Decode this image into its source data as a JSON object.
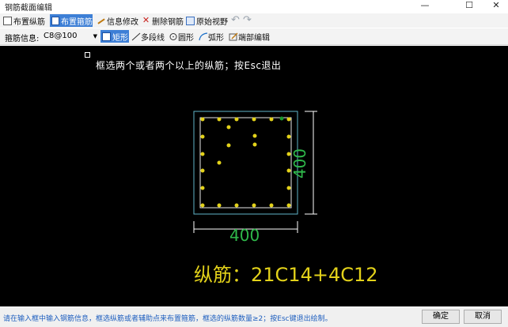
{
  "window": {
    "title": "钢筋截面编辑",
    "min_glyph": "—",
    "max_glyph": "☐",
    "close_glyph": "✕"
  },
  "toolbar1": {
    "items": [
      {
        "label": "布置纵筋",
        "icon": "square-icon"
      },
      {
        "label": "布置箍筋",
        "icon": "stirrup-icon",
        "active": true
      },
      {
        "label": "信息修改",
        "icon": "pencil-icon"
      },
      {
        "label": "删除钢筋",
        "icon": "delete-x-icon"
      },
      {
        "label": "原始视野",
        "icon": "zoom-extents-icon"
      }
    ],
    "undo_glyph": "↶",
    "redo_glyph": "↷"
  },
  "toolbar2": {
    "stirrup_label": "箍筋信息:",
    "stirrup_value": "C8@100",
    "shapes": [
      {
        "label": "矩形",
        "icon": "rect-icon",
        "active": true
      },
      {
        "label": "多段线",
        "icon": "polyline-icon"
      },
      {
        "label": "圆形",
        "icon": "circle-icon"
      },
      {
        "label": "弧形",
        "icon": "arc-icon"
      },
      {
        "label": "端部编辑",
        "icon": "end-edit-icon"
      }
    ]
  },
  "canvas": {
    "prompt": "框选两个或者两个以上的纵筋；按Esc退出",
    "dim_width": "400",
    "dim_height": "400",
    "rebar_label": "纵筋：21C14+4C12",
    "colors": {
      "background": "#000000",
      "section_outline": "#5fb4c8",
      "stirrup": "#e8e8e8",
      "rebar": "#e3d21a",
      "rebar_selected": "#1a9a2e",
      "dimension": "#ffffff",
      "dim_text": "#2fb84a",
      "rebar_text": "#e3d21a"
    }
  },
  "status": {
    "message": "请在输入框中输入钢筋信息，框选纵筋或者辅助点来布置箍筋，框选的纵筋数量≥2；按Esc键退出绘制。",
    "ok_label": "确定",
    "cancel_label": "取消"
  }
}
